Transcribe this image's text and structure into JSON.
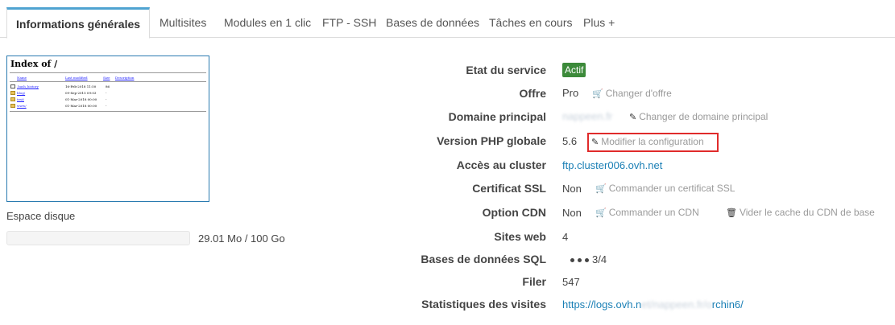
{
  "tabs": [
    {
      "label": "Informations générales",
      "active": true
    },
    {
      "label": "Multisites"
    },
    {
      "label": "Modules en 1 clic"
    },
    {
      "label": "FTP - SSH"
    },
    {
      "label": "Bases de données"
    },
    {
      "label": "Tâches en cours"
    },
    {
      "label": "Plus +"
    }
  ],
  "preview": {
    "title": "Index of /",
    "headers": [
      "Name",
      "Last modified",
      "Size",
      "Description"
    ],
    "rows": [
      {
        "name": ".bash_history",
        "modified": "16-Feb-2018 11:50",
        "size": "86"
      },
      {
        "name": "blog/",
        "modified": "09-Sep-2015 09:03",
        "size": "-"
      },
      {
        "name": "test/",
        "modified": "01-Mar-2018 00:00",
        "size": "-"
      },
      {
        "name": "www/",
        "modified": "01-Mar-2018 00:00",
        "size": "-"
      }
    ]
  },
  "disk": {
    "label": "Espace disque",
    "usage_text": "29.01 Mo / 100 Go",
    "used_fraction": 0.0003
  },
  "info": {
    "etat_label": "Etat du service",
    "etat_value": "Actif",
    "offre_label": "Offre",
    "offre_value": "Pro",
    "offre_action": "Changer d'offre",
    "domaine_label": "Domaine principal",
    "domaine_value": "nappeen.fr",
    "domaine_action": "Changer de domaine principal",
    "php_label": "Version PHP globale",
    "php_value": "5.6",
    "php_action": "Modifier la configuration",
    "cluster_label": "Accès au cluster",
    "cluster_value": "ftp.cluster006.ovh.net",
    "ssl_label": "Certificat SSL",
    "ssl_value": "Non",
    "ssl_action": "Commander un certificat SSL",
    "cdn_label": "Option CDN",
    "cdn_value": "Non",
    "cdn_action": "Commander un CDN",
    "cdn_action2": "Vider le cache du CDN de base",
    "sites_label": "Sites web",
    "sites_value": "4",
    "sql_label": "Bases de données SQL",
    "sql_value": "3/4",
    "filer_label": "Filer",
    "filer_value": "547",
    "stats_label": "Statistiques des visites",
    "stats_prefix": "https://logs.ovh.n",
    "stats_blur": "et/nappeen.fr/o",
    "stats_suffix": "rchin6/"
  },
  "colors": {
    "accent": "#4fa3d1",
    "active_badge": "#3c8a3a",
    "highlight": "#e02b2b",
    "link": "#1a7fb5"
  }
}
